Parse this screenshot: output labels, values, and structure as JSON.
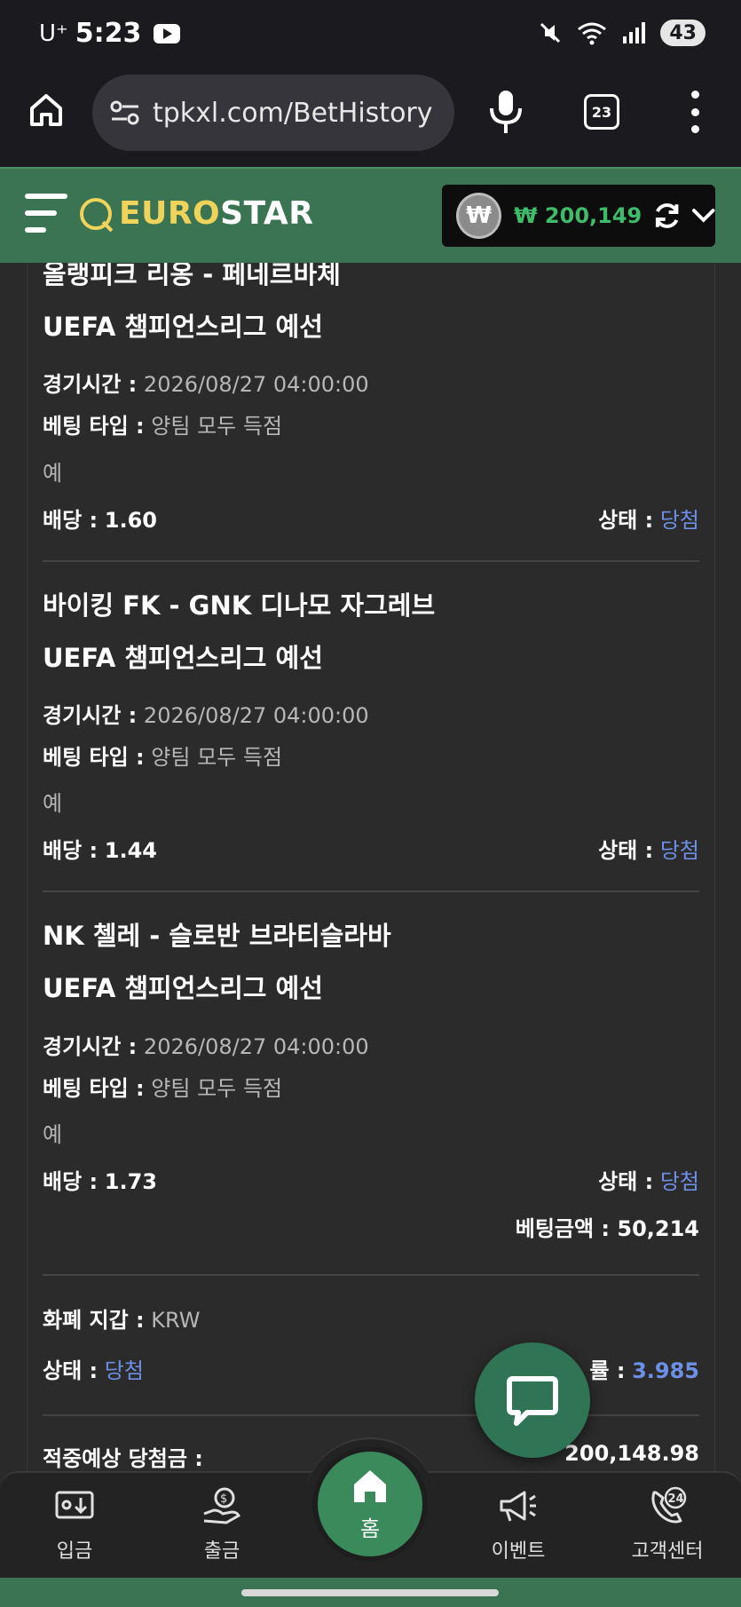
{
  "status_bar": {
    "carrier": "U⁺",
    "time": "5:23",
    "battery": "43"
  },
  "browser": {
    "url": "tpkxl.com/BetHistory",
    "tab_count": "23"
  },
  "header": {
    "logo_euro": "EURO",
    "logo_star": "STAR",
    "currency_symbol": "₩",
    "balance": "₩ 200,149"
  },
  "bets": [
    {
      "match": "올랭피크 리옹 - 페네르바체",
      "league": "UEFA 챔피언스리그 예선",
      "time_label": "경기시간 :",
      "time_value": "2026/08/27 04:00:00",
      "type_label": "베팅 타입 :",
      "type_value": "양팀 모두 득점",
      "pick": "예",
      "odds_label": "배당 :",
      "odds_value": "1.60",
      "status_label": "상태 :",
      "status_value": "당첨"
    },
    {
      "match": "바이킹 FK - GNK 디나모 자그레브",
      "league": "UEFA 챔피언스리그 예선",
      "time_label": "경기시간 :",
      "time_value": "2026/08/27 04:00:00",
      "type_label": "베팅 타입 :",
      "type_value": "양팀 모두 득점",
      "pick": "예",
      "odds_label": "배당 :",
      "odds_value": "1.44",
      "status_label": "상태 :",
      "status_value": "당첨"
    },
    {
      "match": "NK 첼레 - 슬로반 브라티슬라바",
      "league": "UEFA 챔피언스리그 예선",
      "time_label": "경기시간 :",
      "time_value": "2026/08/27 04:00:00",
      "type_label": "베팅 타입 :",
      "type_value": "양팀 모두 득점",
      "pick": "예",
      "odds_label": "배당 :",
      "odds_value": "1.73",
      "status_label": "상태 :",
      "status_value": "당첨",
      "stake_label": "베팅금액 :",
      "stake_value": "50,214"
    }
  ],
  "summary": {
    "wallet_label": "화폐 지갑 :",
    "wallet_value": "KRW",
    "status_label": "상태 :",
    "status_value": "당첨",
    "rate_label_partial": "률 :",
    "rate_value": "3.985",
    "cutoff_label": "적중예상 당첨금 :",
    "cutoff_value": "200,148.98"
  },
  "bottom_nav": {
    "deposit": "입금",
    "withdraw": "출금",
    "home": "홈",
    "event": "이벤트",
    "support": "고객센터",
    "support_badge": "24"
  }
}
